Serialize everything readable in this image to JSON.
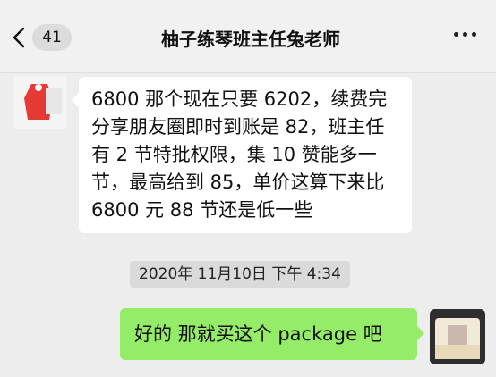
{
  "header": {
    "back_count": "41",
    "title": "柚子练琴班主任兔老师"
  },
  "messages": [
    {
      "side": "left",
      "text": "6800 那个现在只要 6202，续费完分享朋友圈即时到账是 82，班主任有 2 节特批权限，集 10 赞能多一节，最高给到 85，单价这算下来比 6800 元 88 节还是低一些"
    },
    {
      "side": "right",
      "text": "好的 那就买这个 package 吧"
    }
  ],
  "timestamp": "2020年 11月10日 下午 4:34",
  "colors": {
    "background": "#ededed",
    "sent_bubble": "#95ec69",
    "received_bubble": "#ffffff",
    "timestamp_bg": "#dadada"
  },
  "icons": {
    "back": "chevron-left-icon",
    "more": "more-dots-icon"
  }
}
